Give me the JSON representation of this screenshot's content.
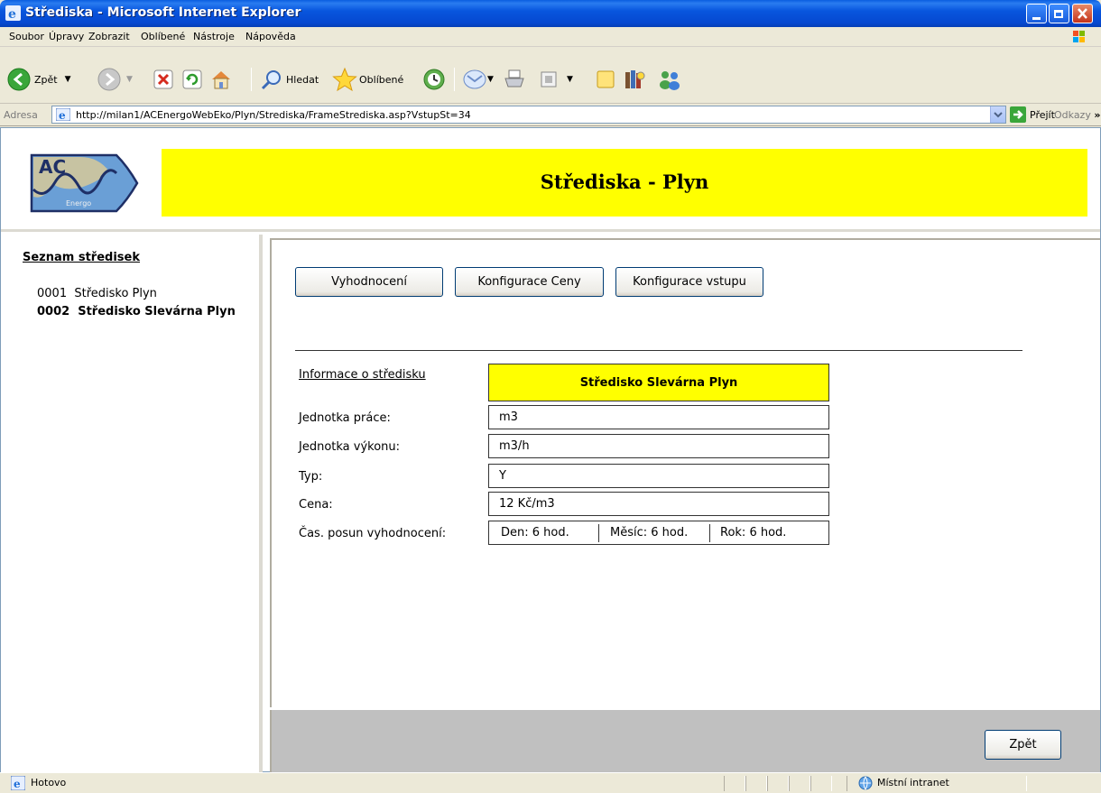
{
  "window": {
    "title": "Střediska - Microsoft Internet Explorer"
  },
  "menu": {
    "items": [
      "Soubor",
      "Úpravy",
      "Zobrazit",
      "Oblíbené",
      "Nástroje",
      "Nápověda"
    ]
  },
  "toolbar": {
    "back_label": "Zpět",
    "search_label": "Hledat",
    "favorites_label": "Oblíbené"
  },
  "address": {
    "label": "Adresa",
    "url": "http://milan1/ACEnergoWebEko/Plyn/Strediska/FrameStrediska.asp?VstupSt=34",
    "go_label": "Přejít",
    "links_label": "Odkazy"
  },
  "header": {
    "title": "Střediska - Plyn",
    "logo_text": "AC",
    "logo_subtext": "Energo"
  },
  "sidebar": {
    "heading": "Seznam středisek",
    "items": [
      {
        "label": "0001  Středisko Plyn"
      },
      {
        "label": "0002  Středisko Slevárna Plyn"
      }
    ]
  },
  "main": {
    "buttons": {
      "evaluation": "Vyhodnocení",
      "price_config": "Konfigurace Ceny",
      "input_config": "Konfigurace vstupu"
    },
    "info": {
      "heading": "Informace o středisku",
      "name": "Středisko Slevárna Plyn",
      "rows": [
        {
          "label": "Jednotka práce:",
          "value": "m3"
        },
        {
          "label": "Jednotka výkonu:",
          "value": "m3/h"
        },
        {
          "label": "Typ:",
          "value": "Y"
        },
        {
          "label": "Cena:",
          "value": "12 Kč/m3"
        }
      ],
      "shift_label": "Čas. posun vyhodnocení:",
      "shift_day": "Den: 6 hod.",
      "shift_month": "Měsíc: 6 hod.",
      "shift_year": "Rok: 6 hod."
    },
    "back_button": "Zpět"
  },
  "status": {
    "text": "Hotovo",
    "zone": "Místní intranet"
  },
  "colors": {
    "header_yellow": "#ffff00",
    "titlebar_blue": "#0856de",
    "bottom_gray": "#c0c0c0"
  }
}
